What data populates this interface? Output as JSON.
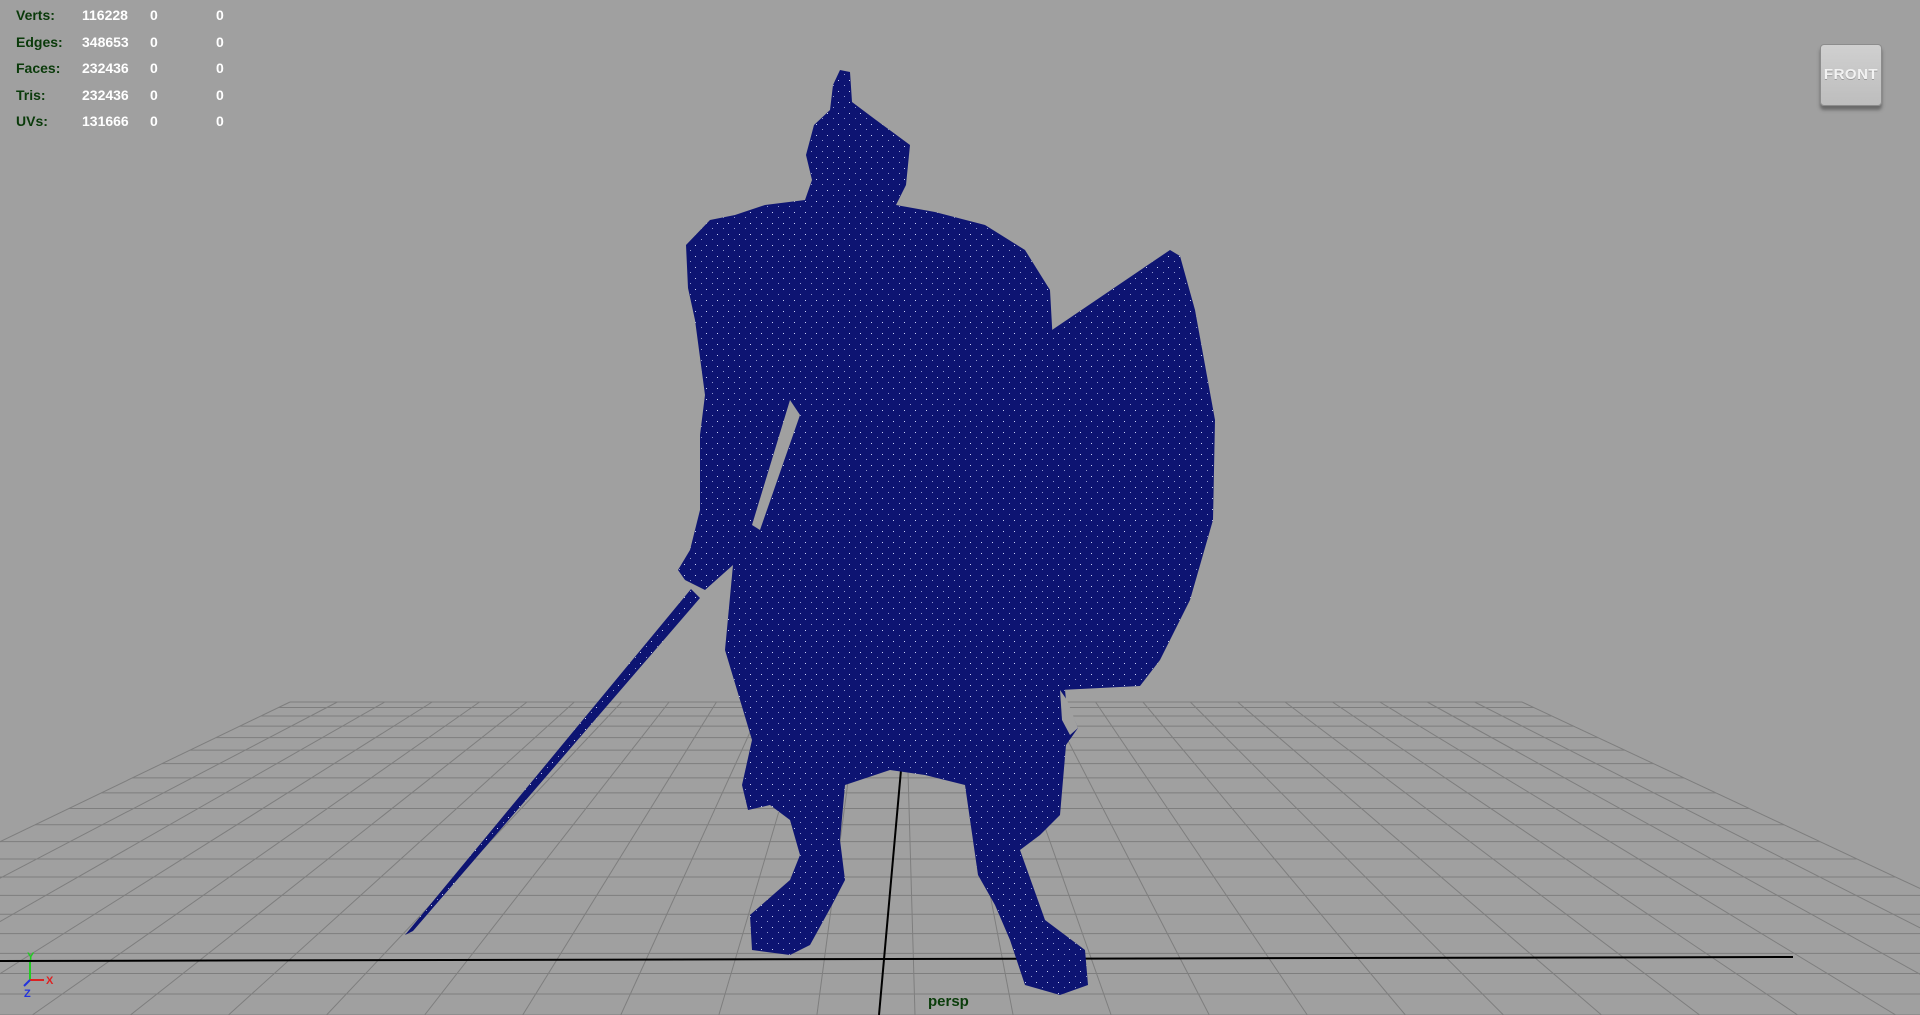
{
  "hud": {
    "stats": [
      {
        "label": "Verts:",
        "values": [
          "116228",
          "0",
          "0"
        ]
      },
      {
        "label": "Edges:",
        "values": [
          "348653",
          "0",
          "0"
        ]
      },
      {
        "label": "Faces:",
        "values": [
          "232436",
          "0",
          "0"
        ]
      },
      {
        "label": "Tris:",
        "values": [
          "232436",
          "0",
          "0"
        ]
      },
      {
        "label": "UVs:",
        "values": [
          "131666",
          "0",
          "0"
        ]
      }
    ]
  },
  "viewcube": {
    "face_label": "FRONT"
  },
  "viewport": {
    "camera_label": "persp",
    "background_color": "#a0a0a0",
    "grid_color": "#7e7e7e",
    "axis_line_color": "#000000",
    "model_color": "#0d1472",
    "model_wire_color": "#c8cff5"
  },
  "axis_gizmo": {
    "y_label": "Y",
    "x_label": "X",
    "z_label": "Z",
    "y_color": "#22cc22",
    "x_color": "#dd2222",
    "z_color": "#2233dd"
  },
  "model": {
    "name": "armored-knight-with-sword-and-shield"
  }
}
